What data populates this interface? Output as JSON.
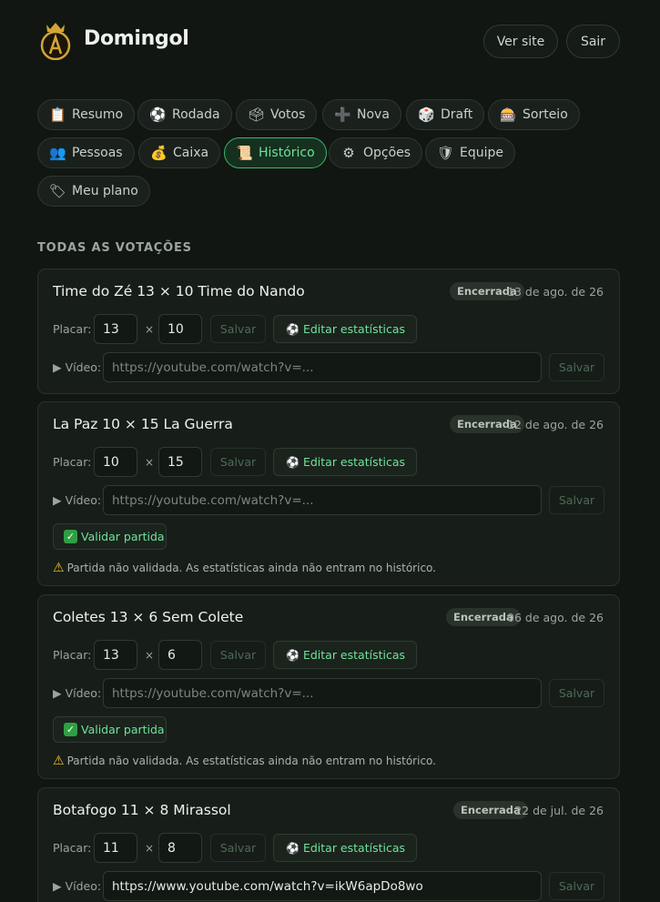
{
  "header": {
    "brand": "Domingol",
    "ver_site": "Ver site",
    "sair": "Sair"
  },
  "nav": {
    "items": [
      {
        "icon": "📋",
        "label": "Resumo"
      },
      {
        "icon": "⚽",
        "label": "Rodada"
      },
      {
        "icon": "🗳",
        "label": "Votos"
      },
      {
        "icon": "➕",
        "label": "Nova"
      },
      {
        "icon": "🎲",
        "label": "Draft"
      },
      {
        "icon": "🎰",
        "label": "Sorteio"
      },
      {
        "icon": "👥",
        "label": "Pessoas"
      },
      {
        "icon": "💰",
        "label": "Caixa"
      },
      {
        "icon": "📜",
        "label": "Histórico"
      },
      {
        "icon": "⚙",
        "label": "Opções"
      },
      {
        "icon": "🛡",
        "label": "Equipe"
      },
      {
        "icon": "🏷",
        "label": "Meu plano"
      }
    ],
    "active": "Histórico"
  },
  "section_title": "TODAS AS VOTAÇÕES",
  "labels": {
    "placar": "Placar:",
    "times": "×",
    "salvar": "Salvar",
    "editar": "Editar estatísticas",
    "video": "▶ Vídeo:",
    "video_placeholder": "https://youtube.com/watch?v=...",
    "validar": "Validar partida",
    "warning": "Partida não validada. As estatísticas ainda não entram no histórico."
  },
  "matches": [
    {
      "title": "Time do Zé 13 × 10 Time do Nando",
      "status": "Encerrada",
      "date": "13 de ago. de 26",
      "home": "13",
      "away": "10",
      "video": "",
      "validated": true
    },
    {
      "title": "La Paz 10 × 15 La Guerra",
      "status": "Encerrada",
      "date": "12 de ago. de 26",
      "home": "10",
      "away": "15",
      "video": "",
      "validated": false
    },
    {
      "title": "Coletes 13 × 6 Sem Colete",
      "status": "Encerrada",
      "date": "06 de ago. de 26",
      "home": "13",
      "away": "6",
      "video": "",
      "validated": false
    },
    {
      "title": "Botafogo 11 × 8 Mirassol",
      "status": "Encerrada",
      "date": "22 de jul. de 26",
      "home": "11",
      "away": "8",
      "video": "https://www.youtube.com/watch?v=ikW6apDo8wo",
      "validated": true
    }
  ]
}
